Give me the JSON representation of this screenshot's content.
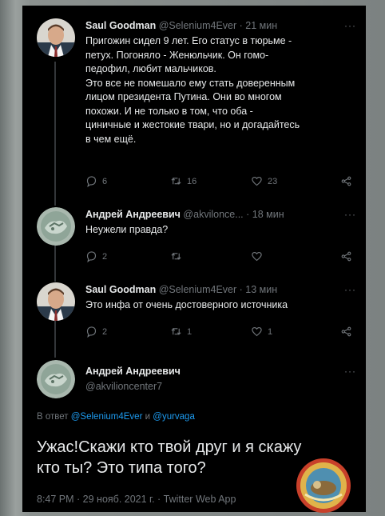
{
  "tweets": [
    {
      "name": "Saul Goodman",
      "handle": "@Selenium4Ever",
      "separator": "·",
      "time": "21 мин",
      "more": "···",
      "lines": [
        "Пригожин сидел 9 лет. Его статус в тюрьме -",
        "петух. Погоняло - Женюльчик. Он гомо-",
        "педофил, любит мальчиков.",
        "Это все не помешало ему стать доверенным",
        "лицом президента Путина. Они во многом",
        "похожи. И не только в том, что оба -",
        "циничные и жестокие твари, но и догадайтесь",
        "в чем ещё."
      ],
      "replies": "6",
      "retweets": "16",
      "likes": "23"
    },
    {
      "name": "Андрей Андреевич",
      "handle": "@akvilonce...",
      "separator": "·",
      "time": "18 мин",
      "more": "···",
      "lines": [
        "Неужели правда?"
      ],
      "replies": "2",
      "retweets": "",
      "likes": ""
    },
    {
      "name": "Saul Goodman",
      "handle": "@Selenium4Ever",
      "separator": "·",
      "time": "13 мин",
      "more": "···",
      "lines": [
        "Это инфа от очень достоверного источника"
      ],
      "replies": "2",
      "retweets": "1",
      "likes": "1"
    }
  ],
  "main": {
    "name": "Андрей Андреевич",
    "handle": "@akvilioncenter7",
    "more": "···",
    "reply_prefix": "В ответ",
    "reply_user1": "@Selenium4Ever",
    "reply_and": "и",
    "reply_user2": "@yurvaga",
    "text_line1": "Ужас!Скажи кто твой друг и я скажу",
    "text_line2": "кто ты? Это типа того?",
    "meta": "8:47 PM · 29 нояб. 2021 г. · Twitter Web App"
  },
  "colors": {
    "background": "#000000",
    "text": "#e7e9ea",
    "muted": "#71767b",
    "link": "#1d9bf0"
  },
  "icons": [
    "reply-icon",
    "retweet-icon",
    "like-icon",
    "share-icon",
    "more-icon"
  ]
}
